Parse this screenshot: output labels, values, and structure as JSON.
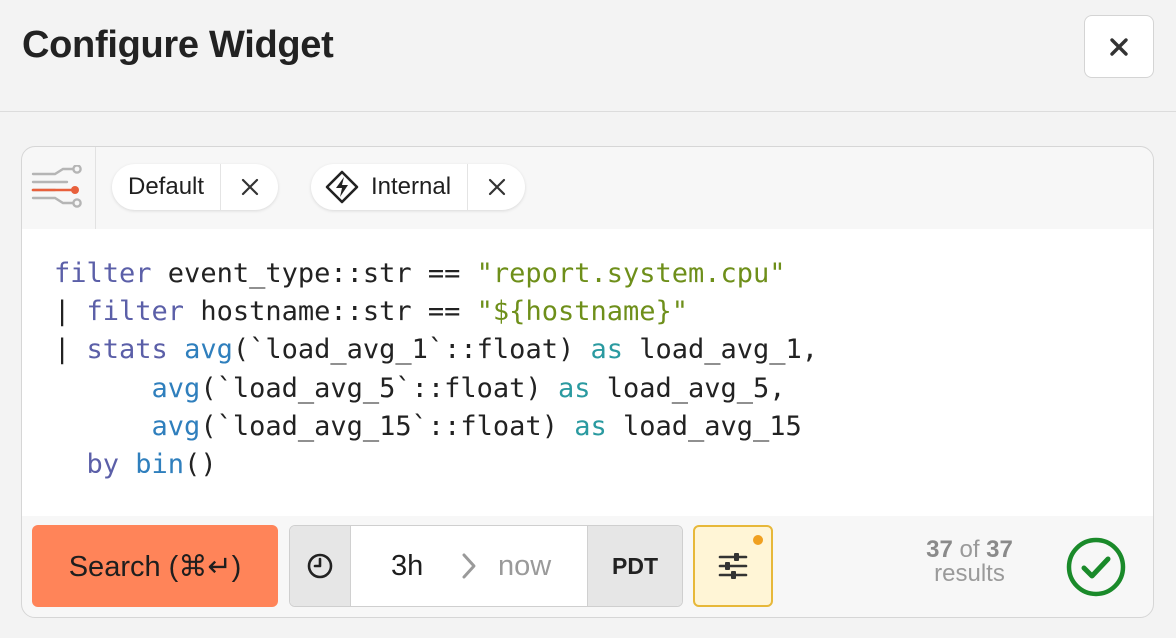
{
  "dialog": {
    "title": "Configure Widget",
    "close_icon": "close-icon"
  },
  "filters": {
    "datasets_icon": "pipeline-datasets-icon",
    "chips": [
      {
        "label": "Default",
        "icon": "",
        "remove_icon": "x-icon"
      },
      {
        "label": "Internal",
        "icon": "lightning-diamond-icon",
        "remove_icon": "x-icon"
      }
    ]
  },
  "query": {
    "lines": [
      "filter event_type::str == \"report.system.cpu\"",
      "| filter hostname::str == \"${hostname}\"",
      "| stats avg(`load_avg_1`::float) as load_avg_1,",
      "      avg(`load_avg_5`::float) as load_avg_5,",
      "      avg(`load_avg_15`::float) as load_avg_15",
      "  by bin()"
    ]
  },
  "toolbar": {
    "search_label": "Search (⌘↵)",
    "time_range": {
      "start": "3h",
      "end": "now",
      "timezone": "PDT"
    },
    "results": {
      "shown": "37",
      "of": "of",
      "total": "37",
      "label": "results"
    },
    "accent_color": "#ff8459",
    "status": "success"
  }
}
